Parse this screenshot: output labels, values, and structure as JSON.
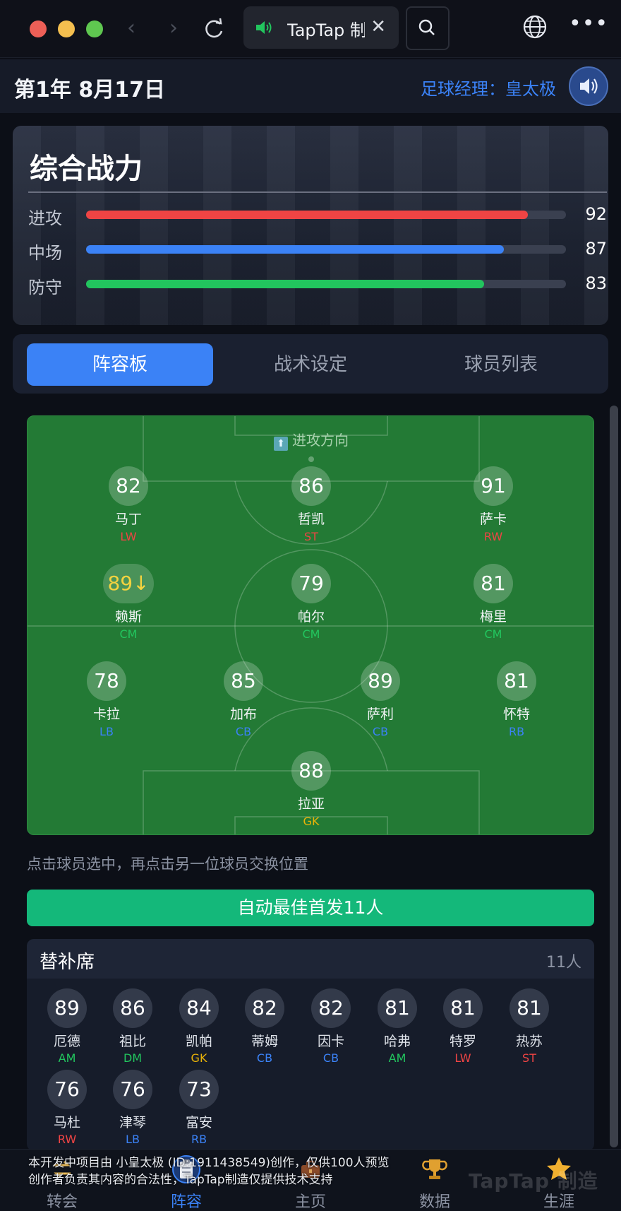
{
  "browser": {
    "tab_title": "TapTap 制",
    "tab_close": "✕"
  },
  "header": {
    "date": "第1年 8月17日",
    "manager": "足球经理：皇太极"
  },
  "power": {
    "title": "综合战力",
    "stats": [
      {
        "label": "进攻",
        "value": 92,
        "color": "#ef4444"
      },
      {
        "label": "中场",
        "value": 87,
        "color": "#3b82f6"
      },
      {
        "label": "防守",
        "value": 83,
        "color": "#22c55e"
      }
    ]
  },
  "tabs": [
    "阵容板",
    "战术设定",
    "球员列表"
  ],
  "pitch": {
    "attack_direction": "进攻方向",
    "players": [
      {
        "rating": "82",
        "name": "马丁",
        "pos": "LW",
        "pos_color": "#ef4444"
      },
      {
        "rating": "86",
        "name": "哲凯",
        "pos": "ST",
        "pos_color": "#ef4444"
      },
      {
        "rating": "91",
        "name": "萨卡",
        "pos": "RW",
        "pos_color": "#ef4444"
      },
      {
        "rating": "89↓",
        "name": "赖斯",
        "pos": "CM",
        "pos_color": "#22c55e"
      },
      {
        "rating": "79",
        "name": "帕尔",
        "pos": "CM",
        "pos_color": "#22c55e"
      },
      {
        "rating": "81",
        "name": "梅里",
        "pos": "CM",
        "pos_color": "#22c55e"
      },
      {
        "rating": "78",
        "name": "卡拉",
        "pos": "LB",
        "pos_color": "#3b82f6"
      },
      {
        "rating": "85",
        "name": "加布",
        "pos": "CB",
        "pos_color": "#3b82f6"
      },
      {
        "rating": "89",
        "name": "萨利",
        "pos": "CB",
        "pos_color": "#3b82f6"
      },
      {
        "rating": "81",
        "name": "怀特",
        "pos": "RB",
        "pos_color": "#3b82f6"
      },
      {
        "rating": "88",
        "name": "拉亚",
        "pos": "GK",
        "pos_color": "#eab308"
      }
    ]
  },
  "hint": "点击球员选中，再点击另一位球员交换位置",
  "auto_button": "自动最佳首发11人",
  "bench": {
    "title": "替补席",
    "count": "11人",
    "players": [
      {
        "rating": "89",
        "name": "厄德",
        "pos": "AM",
        "pos_color": "#22c55e"
      },
      {
        "rating": "86",
        "name": "祖比",
        "pos": "DM",
        "pos_color": "#22c55e"
      },
      {
        "rating": "84",
        "name": "凯帕",
        "pos": "GK",
        "pos_color": "#eab308"
      },
      {
        "rating": "82",
        "name": "蒂姆",
        "pos": "CB",
        "pos_color": "#3b82f6"
      },
      {
        "rating": "82",
        "name": "因卡",
        "pos": "CB",
        "pos_color": "#3b82f6"
      },
      {
        "rating": "81",
        "name": "哈弗",
        "pos": "AM",
        "pos_color": "#22c55e"
      },
      {
        "rating": "81",
        "name": "特罗",
        "pos": "LW",
        "pos_color": "#ef4444"
      },
      {
        "rating": "81",
        "name": "热苏",
        "pos": "ST",
        "pos_color": "#ef4444"
      },
      {
        "rating": "76",
        "name": "马杜",
        "pos": "RW",
        "pos_color": "#ef4444"
      },
      {
        "rating": "76",
        "name": "津琴",
        "pos": "LB",
        "pos_color": "#3b82f6"
      },
      {
        "rating": "73",
        "name": "富安",
        "pos": "RB",
        "pos_color": "#3b82f6"
      }
    ]
  },
  "notice": {
    "line1": "本开发中项目由 小皇太极 (ID:1911438549)创作，仅供100人预览",
    "line2": "创作者负责其内容的合法性，TapTap制造仅提供技术支持"
  },
  "watermark": "TapTap 制造",
  "nav": [
    {
      "label": "转会",
      "icon": "transfer-icon"
    },
    {
      "label": "阵容",
      "icon": "clipboard-icon"
    },
    {
      "label": "主页",
      "icon": "briefcase-icon"
    },
    {
      "label": "数据",
      "icon": "trophy-icon"
    },
    {
      "label": "生涯",
      "icon": "star-icon"
    }
  ]
}
